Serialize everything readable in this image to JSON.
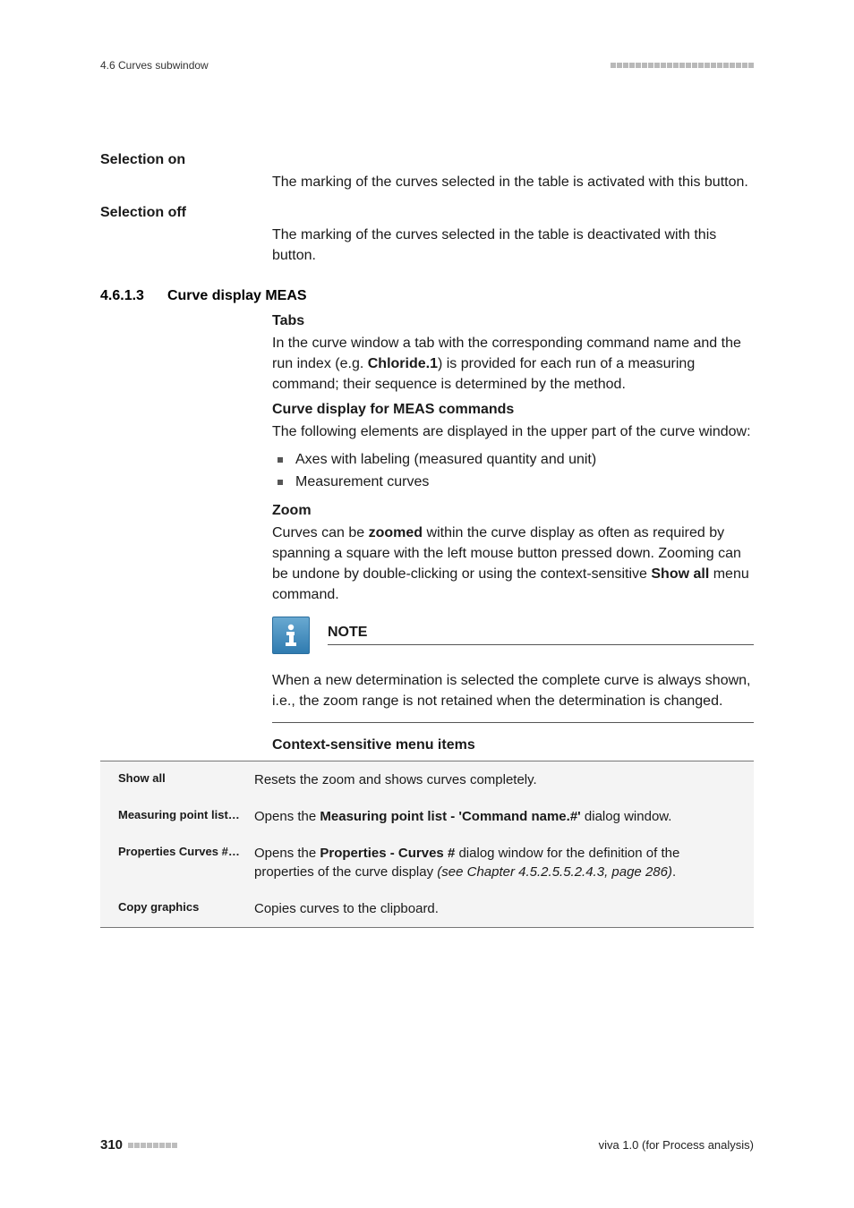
{
  "header": {
    "running_head": "4.6 Curves subwindow"
  },
  "sections": {
    "selection_on": {
      "label": "Selection on",
      "text": "The marking of the curves selected in the table is activated with this button."
    },
    "selection_off": {
      "label": "Selection off",
      "text": "The marking of the curves selected in the table is deactivated with this button."
    },
    "heading_4613": {
      "number": "4.6.1.3",
      "title": "Curve display MEAS"
    },
    "tabs": {
      "title": "Tabs",
      "para_pre": "In the curve window a tab with the corresponding command name and the run index (e.g. ",
      "para_bold": "Chloride.1",
      "para_post": ") is provided for each run of a measuring command; their sequence is determined by the method."
    },
    "meas": {
      "title": "Curve display for MEAS commands",
      "para": "The following elements are displayed in the upper part of the curve window:",
      "bullets": [
        "Axes with labeling (measured quantity and unit)",
        "Measurement curves"
      ]
    },
    "zoom": {
      "title": "Zoom",
      "para_pre": "Curves can be ",
      "para_bold1": "zoomed",
      "para_mid": " within the curve display as often as required by spanning a square with the left mouse button pressed down. Zooming can be undone by double-clicking or using the context-sensitive ",
      "para_bold2": "Show all",
      "para_post": " menu command."
    },
    "note": {
      "title": "NOTE",
      "text": "When a new determination is selected the complete curve is always shown, i.e., the zoom range is not retained when the determination is changed."
    },
    "ctx": {
      "title": "Context-sensitive menu items",
      "rows": [
        {
          "left": "Show all",
          "right_plain": "Resets the zoom and shows curves completely."
        },
        {
          "left": "Measuring point list…",
          "right_pre": "Opens the ",
          "right_bold": "Measuring point list - 'Command name.#'",
          "right_post": " dialog window."
        },
        {
          "left": "Properties Curves #…",
          "right_pre": "Opens the ",
          "right_bold": "Properties - Curves #",
          "right_mid": " dialog window for the definition of the properties of the curve display ",
          "right_italic": "(see Chapter 4.5.2.5.5.2.4.3, page 286)",
          "right_post": "."
        },
        {
          "left": "Copy graphics",
          "right_plain": "Copies curves to the clipboard."
        }
      ]
    }
  },
  "footer": {
    "page_number": "310",
    "version": "viva 1.0 (for Process analysis)"
  }
}
